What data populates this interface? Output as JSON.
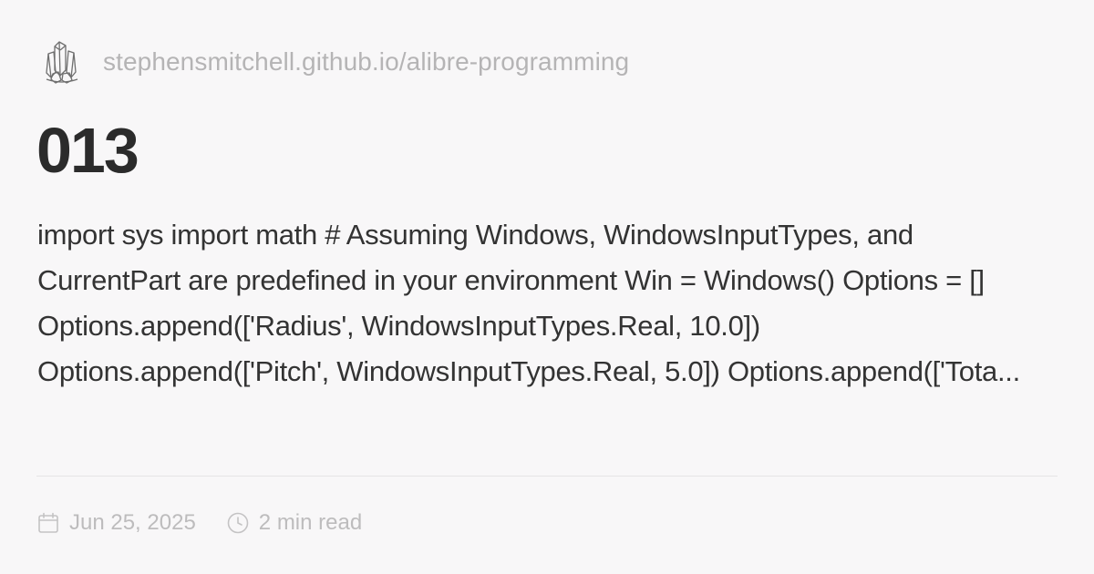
{
  "site": {
    "logo_icon": "crystal-cluster-icon",
    "url": "stephensmitchell.github.io/alibre-programming"
  },
  "post": {
    "title": "013",
    "excerpt": "import sys import math # Assuming Windows, WindowsInputTypes, and CurrentPart are predefined in your environment Win = Windows() Options = [] Options.append(['Radius', WindowsInputTypes.Real, 10.0]) Options.append(['Pitch', WindowsInputTypes.Real, 5.0]) Options.append(['Tota..."
  },
  "meta": {
    "date_icon": "calendar-icon",
    "date": "Jun 25, 2025",
    "read_time_icon": "clock-icon",
    "read_time": "2 min read"
  },
  "colors": {
    "background": "#f8f7f8",
    "title": "#2b2b2b",
    "body_text": "#333333",
    "muted_text": "#b5b4b5",
    "divider": "#e5e4e5"
  }
}
